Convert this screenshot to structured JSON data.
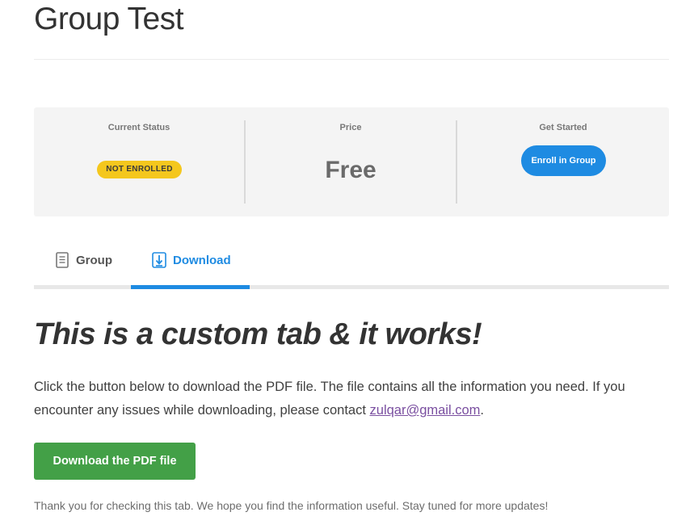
{
  "page": {
    "title": "Group Test"
  },
  "status_card": {
    "status": {
      "label": "Current Status",
      "badge": "NOT ENROLLED",
      "badge_color": "#f4c71d"
    },
    "price": {
      "label": "Price",
      "value": "Free"
    },
    "get_started": {
      "label": "Get Started",
      "button": "Enroll in Group",
      "button_color": "#1e8be2"
    }
  },
  "tabs": [
    {
      "label": "Group",
      "icon": "document-icon",
      "active": false
    },
    {
      "label": "Download",
      "icon": "download-icon",
      "active": true
    }
  ],
  "tab_content": {
    "heading": "This is a custom tab & it works!",
    "paragraph_before": "Click the button below to download the PDF file. The file contains all the information you need. If you encounter any issues while downloading, please contact ",
    "email": "zulqar@gmail.com",
    "paragraph_after": ".",
    "download_button": "Download the PDF file",
    "download_button_color": "#43a047",
    "footer": "Thank you for checking this tab. We hope you find the information useful. Stay tuned for more updates!"
  },
  "colors": {
    "accent": "#1e8be2",
    "link": "#7a4fa0"
  }
}
